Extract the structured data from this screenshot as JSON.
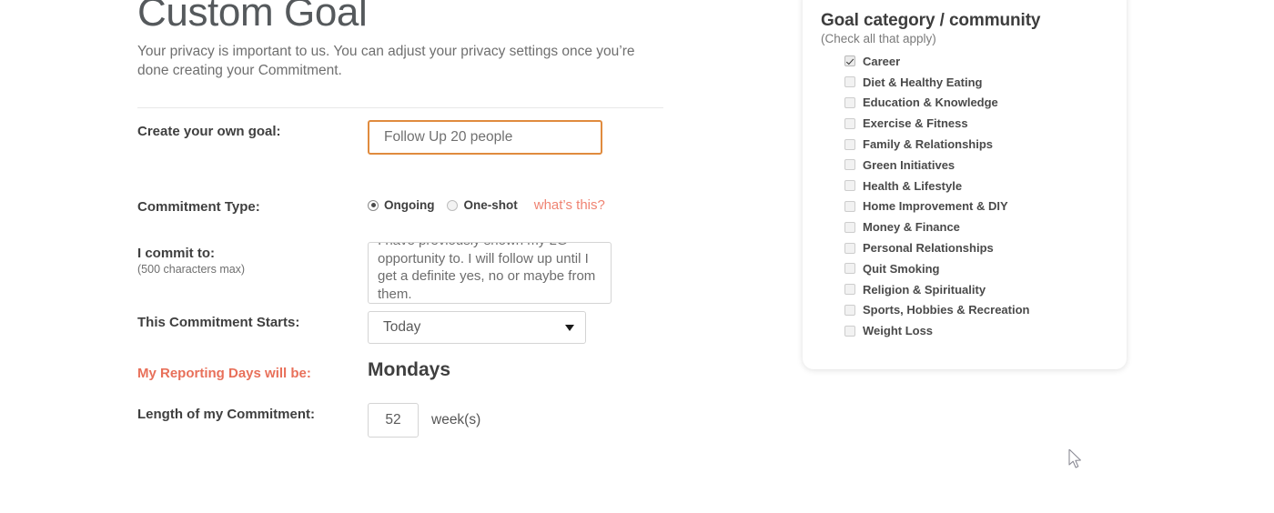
{
  "page": {
    "title": "Custom Goal",
    "intro": "Your privacy is important to us. You can adjust your privacy settings once you’re done creating your Commitment."
  },
  "form": {
    "goal": {
      "label": "Create your own goal:",
      "value": "Follow Up 20 people"
    },
    "commitment_type": {
      "label": "Commitment Type:",
      "options": [
        {
          "label": "Ongoing",
          "selected": true
        },
        {
          "label": "One-shot",
          "selected": false
        }
      ],
      "help_link": "what’s this?"
    },
    "commit_to": {
      "label": "I commit to:",
      "sub_label": "(500 characters max)",
      "value": "I have previously shown my LG opportunity to. I will follow up until I get a definite yes, no or maybe from them."
    },
    "starts": {
      "label": "This Commitment Starts:",
      "value": "Today"
    },
    "reporting_days": {
      "label": "My Reporting Days will be:",
      "value": "Mondays"
    },
    "length": {
      "label": "Length of my Commitment:",
      "value": "52",
      "unit": "week(s)"
    }
  },
  "categories": {
    "title": "Goal category / community",
    "subtitle": "(Check all that apply)",
    "items": [
      {
        "label": "Career",
        "checked": true
      },
      {
        "label": "Diet & Healthy Eating",
        "checked": false
      },
      {
        "label": "Education & Knowledge",
        "checked": false
      },
      {
        "label": "Exercise & Fitness",
        "checked": false
      },
      {
        "label": "Family & Relationships",
        "checked": false
      },
      {
        "label": "Green Initiatives",
        "checked": false
      },
      {
        "label": "Health & Lifestyle",
        "checked": false
      },
      {
        "label": "Home Improvement & DIY",
        "checked": false
      },
      {
        "label": "Money & Finance",
        "checked": false
      },
      {
        "label": "Personal Relationships",
        "checked": false
      },
      {
        "label": "Quit Smoking",
        "checked": false
      },
      {
        "label": "Religion & Spirituality",
        "checked": false
      },
      {
        "label": "Sports, Hobbies & Recreation",
        "checked": false
      },
      {
        "label": "Weight Loss",
        "checked": false
      }
    ]
  },
  "icons": {
    "dropdown": "chevron-down-icon",
    "cursor": "mouse-pointer-icon"
  },
  "colors": {
    "accent_orange": "#e8705a",
    "link_salmon": "#ef8372",
    "input_focus_border": "#e08b3e",
    "text_dark": "#3f3f3f",
    "text_muted": "#6f6f6f"
  }
}
